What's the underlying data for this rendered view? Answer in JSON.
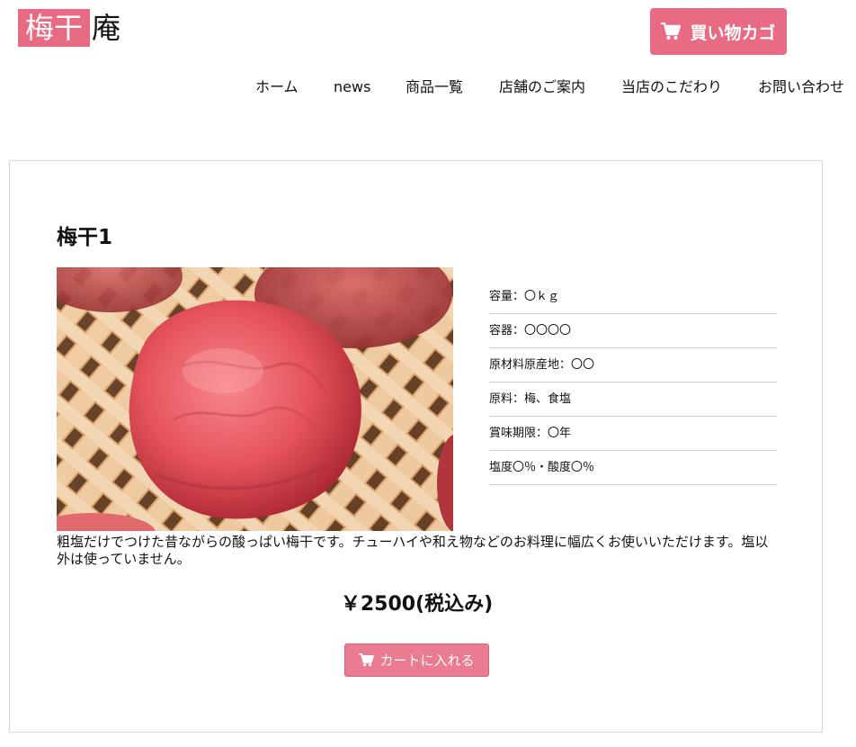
{
  "logo": {
    "mark": "梅干",
    "rest": "庵"
  },
  "header": {
    "cart_label": "買い物カゴ",
    "cart_icon": "shopping-cart-icon"
  },
  "nav": {
    "items": [
      {
        "label": "ホーム"
      },
      {
        "label": "news"
      },
      {
        "label": "商品一覧"
      },
      {
        "label": "店舗のご案内"
      },
      {
        "label": "当店のこだわり"
      },
      {
        "label": "お問い合わせ"
      }
    ]
  },
  "product": {
    "title": "梅干1",
    "specs": [
      "容量：〇ｋｇ",
      "容器：〇〇〇〇",
      "原材料原産地：〇〇",
      "原料：梅、食塩",
      "賞味期限：〇年",
      "塩度〇％・酸度〇％"
    ],
    "description": "粗塩だけでつけた昔ながらの酸っぱい梅干です。チューハイや和え物などのお料理に幅広くお使いいただけます。塩以外は使っていません。",
    "price": "￥2500(税込み)",
    "add_to_cart_label": "カートに入れる"
  },
  "colors": {
    "accent": "#e86a83",
    "button_light": "#eb7b90",
    "border": "#d9d9d9"
  }
}
